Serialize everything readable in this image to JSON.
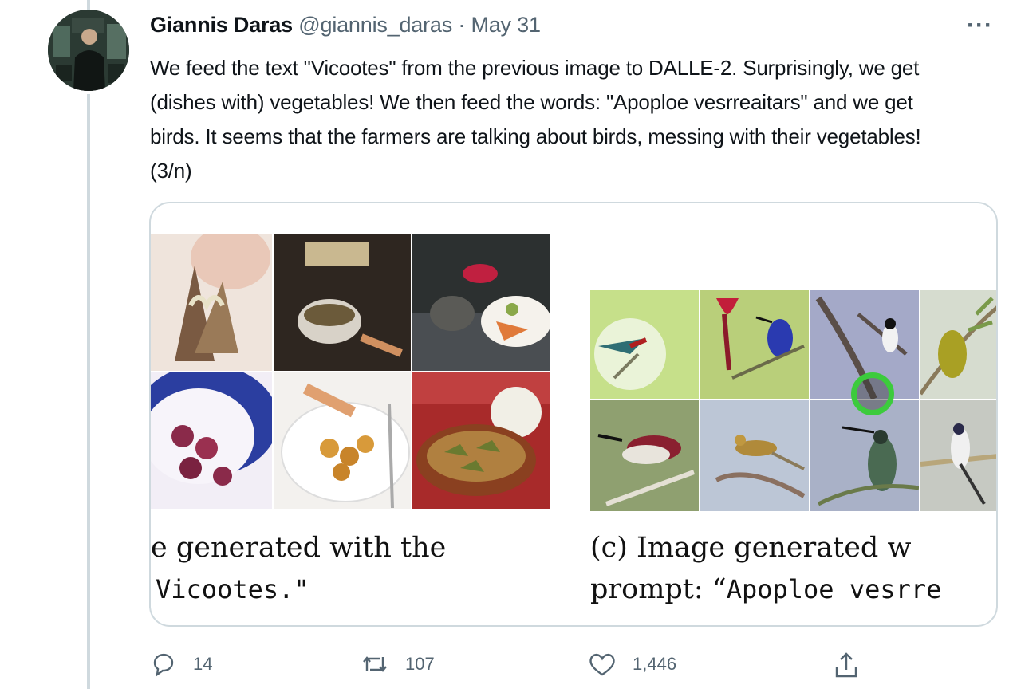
{
  "tweet": {
    "author_name": "Giannis Daras",
    "author_handle": "@giannis_daras",
    "separator": "·",
    "date": "May 31",
    "more_label": "···",
    "text": "We feed the text \"Vicootes\" from the previous image to DALLE-2. Surprisingly, we get (dishes with) vegetables! We then feed the words: \"Apoploe vesrreaitars\" and we get birds. It seems that the farmers are talking about birds, messing with their vegetables! (3/n)"
  },
  "media": {
    "left_caption_line1": "e generated with the",
    "left_caption_line2": "Vicootes.\"",
    "right_caption_line1_label": "(c) Image generated w",
    "right_caption_line2_prefix": "prompt: “",
    "right_caption_line2_mono": "Apoploe vesrre",
    "food_image_count": 6,
    "bird_image_count": 8
  },
  "actions": {
    "reply_icon": "reply-icon",
    "reply_count": "14",
    "retweet_icon": "retweet-icon",
    "retweet_count": "107",
    "like_icon": "heart-icon",
    "like_count": "1,446",
    "share_icon": "share-icon"
  },
  "colors": {
    "text_primary": "#0f1419",
    "text_secondary": "#536471",
    "border": "#cfd9de",
    "cursor_ring": "#3ccb3c"
  }
}
